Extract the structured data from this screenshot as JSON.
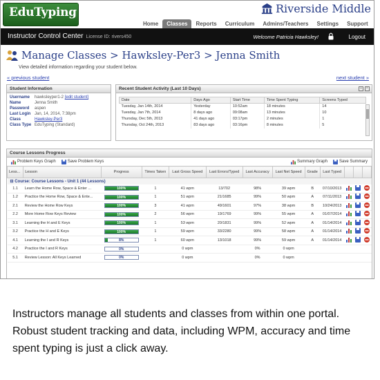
{
  "header": {
    "app_name": "EduTyping",
    "school": "Riverside Middle",
    "nav": [
      "Home",
      "Classes",
      "Reports",
      "Curriculum",
      "Admins/Teachers",
      "Settings",
      "Support"
    ],
    "active_nav": "Classes",
    "control_center": "Instructor Control Center",
    "license": "License ID: rivers450",
    "welcome": "Welcome Patricia Hawksley!",
    "logout": "Logout"
  },
  "page": {
    "breadcrumb": "Manage Classes > Hawksley-Per3 > Jenna Smith",
    "subtitle": "View detailed information regarding your student below.",
    "prev_link": "« previous student",
    "next_link": "next student »"
  },
  "student_info": {
    "title": "Student Information",
    "rows": [
      {
        "key": "Username",
        "value": "hawksleyper1-2",
        "link": "[edit student]"
      },
      {
        "key": "Name",
        "value": "Jenna Smith",
        "link": ""
      },
      {
        "key": "Password",
        "value": "aspen",
        "link": ""
      },
      {
        "key": "Last Login",
        "value": "Jan, 14, 2014, 7:38pm",
        "link": ""
      },
      {
        "key": "Class",
        "value": "",
        "link": "Hawksley-Per3"
      },
      {
        "key": "Class Type",
        "value": "EduTyping (Standard)",
        "link": ""
      }
    ]
  },
  "activity": {
    "title": "Recent Student Activity (Last 10 Days)",
    "columns": [
      "Date",
      "Days Ago",
      "Start Time",
      "Time Spent Typing",
      "Screens Typed"
    ],
    "rows": [
      [
        "Tuesday, Jan 14th, 2014",
        "Yesterday",
        "10:52am",
        "18 minutes",
        "14"
      ],
      [
        "Tuesday, Jan 7th, 2014",
        "8 days ago",
        "09:08am",
        "13 minutes",
        "10"
      ],
      [
        "Thursday, Dec 5th, 2013",
        "41 days ago",
        "03:17pm",
        "2 minutes",
        "1"
      ],
      [
        "Thursday, Oct 24th, 2013",
        "83 days ago",
        "03:16pm",
        "8 minutes",
        "5"
      ]
    ]
  },
  "lessons": {
    "title": "Course Lessons Progress",
    "tools": {
      "problem_graph": "Problem Keys Graph",
      "save_problem": "Save Problem Keys",
      "summary_graph": "Summary Graph",
      "save_summary": "Save Summary"
    },
    "columns": [
      "Less...",
      "Lesson",
      "Progress",
      "Times Taken",
      "Last Gross Speed",
      "Last Errors/Typed",
      "Last Accuracy",
      "Last Net Speed",
      "Grade",
      "Last Typed"
    ],
    "course_label": "Course: Course Lessons - Unit 1 (44 Lessons)",
    "rows": [
      {
        "num": "1.1",
        "lesson": "Learn the Home Row, Space & Enter ...",
        "progress": 100,
        "progress_label": "100%",
        "times": "1",
        "gross": "41 wpm",
        "errors": "13/702",
        "accuracy": "98%",
        "net": "39 wpm",
        "grade": "B",
        "date": "07/10/2013",
        "icons": true
      },
      {
        "num": "1.2",
        "lesson": "Practice the Home Row, Space & Ente...",
        "progress": 100,
        "progress_label": "100%",
        "times": "1",
        "gross": "51 wpm",
        "errors": "21/1685",
        "accuracy": "99%",
        "net": "50 wpm",
        "grade": "A",
        "date": "07/11/2013",
        "icons": true
      },
      {
        "num": "2.1",
        "lesson": "Review the Home Row Keys",
        "progress": 100,
        "progress_label": "100%",
        "times": "3",
        "gross": "41 wpm",
        "errors": "49/1601",
        "accuracy": "97%",
        "net": "38 wpm",
        "grade": "B",
        "date": "10/24/2013",
        "icons": true
      },
      {
        "num": "2.2",
        "lesson": "More Home Row Keys Review",
        "progress": 100,
        "progress_label": "100%",
        "times": "2",
        "gross": "56 wpm",
        "errors": "19/1769",
        "accuracy": "99%",
        "net": "55 wpm",
        "grade": "A",
        "date": "01/07/2014",
        "icons": true
      },
      {
        "num": "3.1",
        "lesson": "Learning the H and E Keys",
        "progress": 100,
        "progress_label": "100%",
        "times": "1",
        "gross": "53 wpm",
        "errors": "20/1831",
        "accuracy": "99%",
        "net": "52 wpm",
        "grade": "A",
        "date": "01/14/2014",
        "icons": true
      },
      {
        "num": "3.2",
        "lesson": "Practice the H and E Keys",
        "progress": 100,
        "progress_label": "100%",
        "times": "1",
        "gross": "59 wpm",
        "errors": "33/2280",
        "accuracy": "99%",
        "net": "58 wpm",
        "grade": "A",
        "date": "01/14/2014",
        "icons": true
      },
      {
        "num": "4.1",
        "lesson": "Learning the I and R Keys",
        "progress": 8,
        "progress_label": "8%",
        "times": "1",
        "gross": "60 wpm",
        "errors": "13/1018",
        "accuracy": "99%",
        "net": "59 wpm",
        "grade": "A",
        "date": "01/14/2014",
        "icons": true
      },
      {
        "num": "4.2",
        "lesson": "Practice the I and R Keys",
        "progress": 0,
        "progress_label": "0%",
        "times": "",
        "gross": "0 wpm",
        "errors": "",
        "accuracy": "0%",
        "net": "0 wpm",
        "grade": "",
        "date": "",
        "icons": false
      },
      {
        "num": "5.1",
        "lesson": "Review Lesson: All Keys Learned",
        "progress": 0,
        "progress_label": "0%",
        "times": "",
        "gross": "0 wpm",
        "errors": "",
        "accuracy": "0%",
        "net": "0 wpm",
        "grade": "",
        "date": "",
        "icons": false
      }
    ]
  },
  "caption": "Instructors manage all students and classes from within one portal. Robust student tracking and data, including WPM, accuracy and time spent typing is just a click away.",
  "colors": {
    "brand_green": "#2e7d32",
    "link_blue": "#2a3fb0",
    "title_blue": "#2a3f88",
    "progress_green": "#1a7a2a",
    "delete_red": "#d03a2a"
  }
}
